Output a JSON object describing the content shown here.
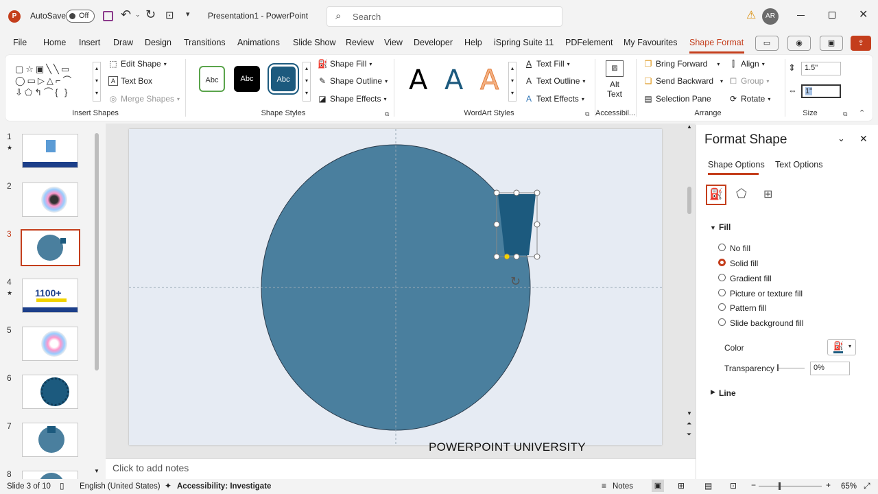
{
  "titlebar": {
    "autosave_label": "AutoSave",
    "autosave_state": "Off",
    "doc_title": "Presentation1  -  PowerPoint",
    "search_placeholder": "Search",
    "avatar_initials": "AR"
  },
  "menu": [
    "File",
    "Home",
    "Insert",
    "Draw",
    "Design",
    "Transitions",
    "Animations",
    "Slide Show",
    "Review",
    "View",
    "Developer",
    "Help",
    "iSpring Suite 11",
    "PDFelement",
    "My Favourites",
    "Shape Format"
  ],
  "ribbon": {
    "edit_shape": "Edit Shape",
    "text_box": "Text Box",
    "merge_shapes": "Merge Shapes",
    "insert_shapes_label": "Insert Shapes",
    "style_abc": "Abc",
    "shape_fill": "Shape Fill",
    "shape_outline": "Shape Outline",
    "shape_effects": "Shape Effects",
    "shape_styles_label": "Shape Styles",
    "wordart_a": "A",
    "text_fill": "Text Fill",
    "text_outline": "Text Outline",
    "text_effects": "Text Effects",
    "wordart_label": "WordArt Styles",
    "alt_text_1": "Alt",
    "alt_text_2": "Text",
    "accessibility_label": "Accessibil...",
    "bring_forward": "Bring Forward",
    "send_backward": "Send Backward",
    "selection_pane": "Selection Pane",
    "align": "Align",
    "group": "Group",
    "rotate": "Rotate",
    "arrange_label": "Arrange",
    "height_value": "1.5\"",
    "width_value": "1\"",
    "size_label": "Size"
  },
  "slides": {
    "numbers": [
      "1",
      "2",
      "3",
      "4",
      "5",
      "6",
      "7",
      "8"
    ],
    "thumb4_text": "1100+"
  },
  "slide": {
    "watermark": "POWERPOINT UNIVERSITY",
    "circle_color": "#4a7f9e",
    "trapezoid_color": "#1c5a7e"
  },
  "notes": {
    "placeholder": "Click to add notes"
  },
  "format_pane": {
    "title": "Format Shape",
    "tab_shape": "Shape Options",
    "tab_text": "Text Options",
    "section_fill": "Fill",
    "options": [
      "No fill",
      "Solid fill",
      "Gradient fill",
      "Picture or texture fill",
      "Pattern fill",
      "Slide background fill"
    ],
    "selected": "Solid fill",
    "color_label": "Color",
    "transparency_label": "Transparency",
    "transparency_value": "0%",
    "section_line": "Line"
  },
  "status": {
    "slide_info": "Slide 3 of 10",
    "language": "English (United States)",
    "accessibility": "Accessibility: Investigate",
    "notes": "Notes",
    "zoom": "65%"
  },
  "colors": {
    "accent": "#c43e1c"
  }
}
